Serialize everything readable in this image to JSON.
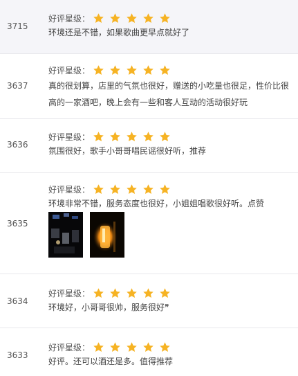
{
  "rating_label": "好评星级：",
  "star_color": "#f6b324",
  "reviews": [
    {
      "id": "3715",
      "stars": 5,
      "text": "环境还是不错，如果歌曲更早点就好了"
    },
    {
      "id": "3637",
      "stars": 5,
      "text": "真的很划算，店里的气氛也很好，赠送的小吃量也很足，性价比很高的一家酒吧，晚上会有一些和客人互动的活动很好玩"
    },
    {
      "id": "3636",
      "stars": 5,
      "text": "氛围很好，歌手小哥哥唱民谣很好听，推荐"
    },
    {
      "id": "3635",
      "stars": 5,
      "text": "环境非常不错，服务态度也很好，小姐姐唱歌很好听。点赞",
      "photos": [
        "bar-photo-1",
        "bar-photo-2"
      ]
    },
    {
      "id": "3634",
      "stars": 5,
      "text": "环境好，小哥哥很帅，服务很好❞"
    },
    {
      "id": "3633",
      "stars": 5,
      "text": "好评。还可以酒还是多。值得推荐"
    }
  ]
}
